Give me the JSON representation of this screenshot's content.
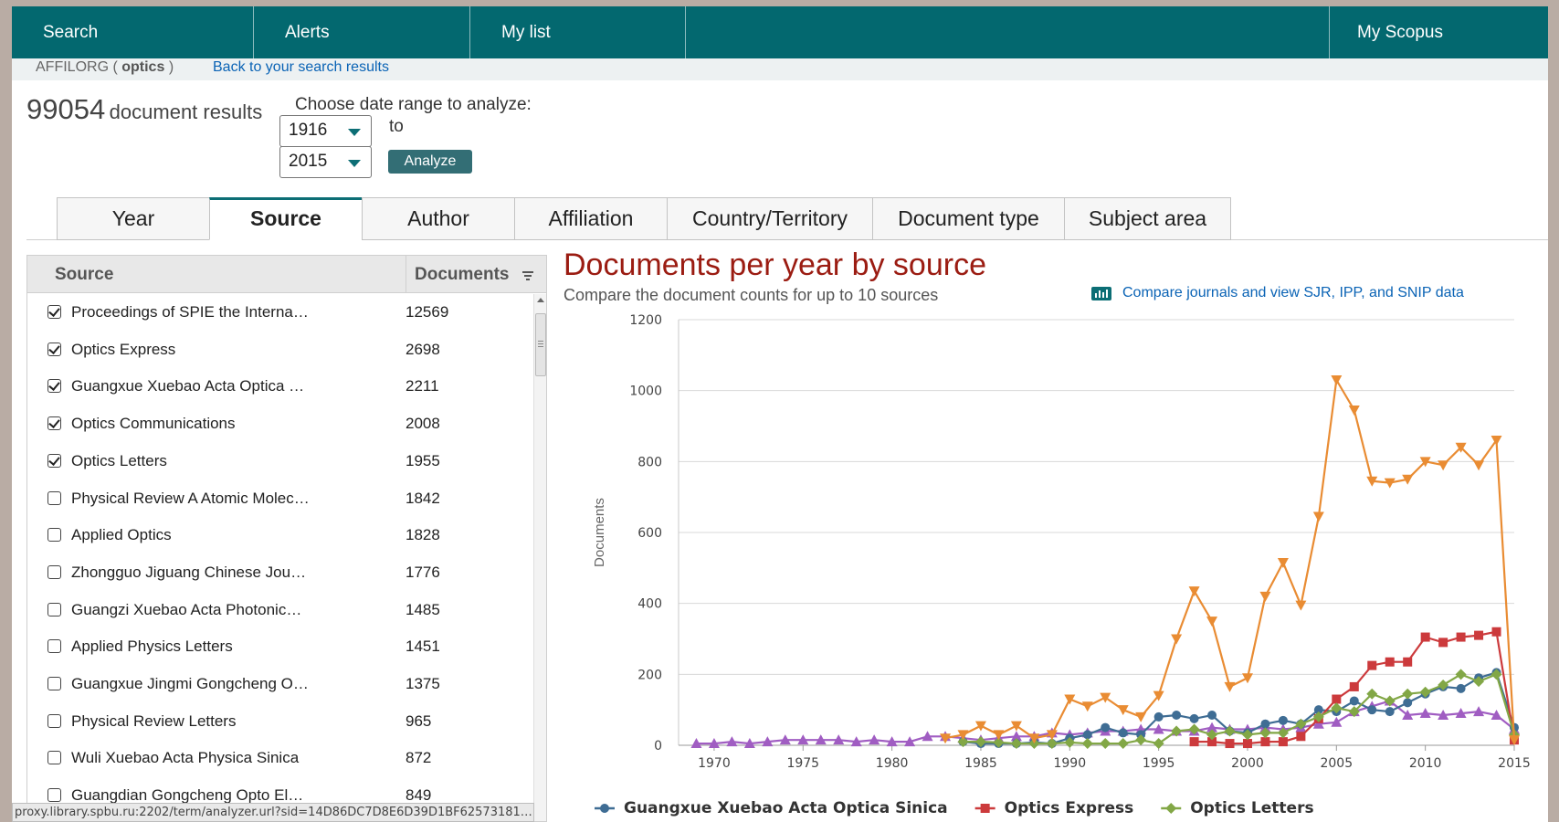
{
  "nav": {
    "search": "Search",
    "alerts": "Alerts",
    "my_list": "My list",
    "my_scopus": "My Scopus"
  },
  "query": {
    "prefix": "AFFILORG (",
    "term": "optics",
    "suffix": ")",
    "back_link": "Back to your search results"
  },
  "results": {
    "count": "99054",
    "label": "document results"
  },
  "date_range": {
    "label": "Choose date range to analyze:",
    "from": "1916",
    "to_label": "to",
    "to": "2015",
    "analyze_label": "Analyze"
  },
  "tabs": [
    {
      "label": "Year"
    },
    {
      "label": "Source"
    },
    {
      "label": "Author"
    },
    {
      "label": "Affiliation"
    },
    {
      "label": "Country/Territory"
    },
    {
      "label": "Document type"
    },
    {
      "label": "Subject area"
    }
  ],
  "active_tab": "Source",
  "sources_table": {
    "col_source": "Source",
    "col_documents": "Documents",
    "rows": [
      {
        "name": "Proceedings of SPIE the Interna…",
        "docs": "12569",
        "checked": true
      },
      {
        "name": "Optics Express",
        "docs": "2698",
        "checked": true
      },
      {
        "name": "Guangxue Xuebao Acta Optica …",
        "docs": "2211",
        "checked": true
      },
      {
        "name": "Optics Communications",
        "docs": "2008",
        "checked": true
      },
      {
        "name": "Optics Letters",
        "docs": "1955",
        "checked": true
      },
      {
        "name": "Physical Review A Atomic Molec…",
        "docs": "1842",
        "checked": false
      },
      {
        "name": "Applied Optics",
        "docs": "1828",
        "checked": false
      },
      {
        "name": "Zhongguo Jiguang Chinese Jou…",
        "docs": "1776",
        "checked": false
      },
      {
        "name": "Guangzi Xuebao Acta Photonic…",
        "docs": "1485",
        "checked": false
      },
      {
        "name": "Applied Physics Letters",
        "docs": "1451",
        "checked": false
      },
      {
        "name": "Guangxue Jingmi Gongcheng O…",
        "docs": "1375",
        "checked": false
      },
      {
        "name": "Physical Review Letters",
        "docs": "965",
        "checked": false
      },
      {
        "name": "Wuli Xuebao Acta Physica Sinica",
        "docs": "872",
        "checked": false
      },
      {
        "name": "Guangdian Gongcheng Opto El…",
        "docs": "849",
        "checked": false
      }
    ]
  },
  "status_bar": "proxy.library.spbu.ru:2202/term/analyzer.url?sid=14D86DC7D8E6D39D1BF62573181…",
  "chart_header": {
    "title": "Documents per year by source",
    "subtitle": "Compare the document counts for up to 10 sources",
    "compare_link": "Compare journals and view SJR, IPP, and SNIP data"
  },
  "colors": {
    "nav_bg": "#03686f",
    "title_red": "#9b1c12",
    "link_blue": "#0a63b5",
    "guangxue": "#3f6d94",
    "optics_express": "#cc3a3c",
    "optics_letters": "#82a746",
    "spie": "#e98c33",
    "optics_communications": "#a05dc2"
  },
  "chart_data": {
    "type": "line",
    "ylabel": "Documents",
    "xlim": [
      1968,
      2015
    ],
    "ylim": [
      0,
      1200
    ],
    "yticks": [
      0,
      200,
      400,
      600,
      800,
      1000,
      1200
    ],
    "xticks": [
      1970,
      1975,
      1980,
      1985,
      1990,
      1995,
      2000,
      2005,
      2010,
      2015
    ],
    "grid": true,
    "legend": "bottom",
    "series": [
      {
        "name": "Guangxue Xuebao Acta Optica Sinica",
        "marker": "circle",
        "x": [
          1984,
          1985,
          1986,
          1987,
          1988,
          1989,
          1990,
          1991,
          1992,
          1993,
          1994,
          1995,
          1996,
          1997,
          1998,
          1999,
          2000,
          2001,
          2002,
          2003,
          2004,
          2005,
          2006,
          2007,
          2008,
          2009,
          2010,
          2011,
          2012,
          2013,
          2014,
          2015
        ],
        "values": [
          10,
          5,
          5,
          5,
          8,
          5,
          20,
          30,
          50,
          35,
          30,
          80,
          85,
          75,
          85,
          40,
          35,
          60,
          70,
          60,
          100,
          95,
          125,
          100,
          95,
          120,
          145,
          165,
          160,
          190,
          205,
          50
        ]
      },
      {
        "name": "Optics Express",
        "marker": "square",
        "x": [
          1997,
          1998,
          1999,
          2000,
          2001,
          2002,
          2003,
          2004,
          2005,
          2006,
          2007,
          2008,
          2009,
          2010,
          2011,
          2012,
          2013,
          2014,
          2015
        ],
        "values": [
          10,
          10,
          5,
          5,
          10,
          10,
          25,
          75,
          130,
          165,
          225,
          235,
          235,
          305,
          290,
          305,
          310,
          320,
          15
        ]
      },
      {
        "name": "Optics Letters",
        "marker": "diamond",
        "x": [
          1984,
          1985,
          1986,
          1987,
          1988,
          1989,
          1990,
          1991,
          1992,
          1993,
          1994,
          1995,
          1996,
          1997,
          1998,
          1999,
          2000,
          2001,
          2002,
          2003,
          2004,
          2005,
          2006,
          2007,
          2008,
          2009,
          2010,
          2011,
          2012,
          2013,
          2014,
          2015
        ],
        "values": [
          10,
          10,
          8,
          5,
          5,
          5,
          8,
          5,
          5,
          5,
          15,
          5,
          40,
          45,
          30,
          40,
          30,
          35,
          35,
          60,
          80,
          105,
          95,
          145,
          125,
          145,
          150,
          170,
          200,
          180,
          200,
          30
        ]
      },
      {
        "marker": "triangle-down",
        "x": [
          1983,
          1984,
          1985,
          1986,
          1987,
          1988,
          1989,
          1990,
          1991,
          1992,
          1993,
          1994,
          1995,
          1996,
          1997,
          1998,
          1999,
          2000,
          2001,
          2002,
          2003,
          2004,
          2005,
          2006,
          2007,
          2008,
          2009,
          2010,
          2011,
          2012,
          2013,
          2014,
          2015
        ],
        "values": [
          20,
          30,
          55,
          30,
          55,
          20,
          30,
          130,
          110,
          135,
          100,
          80,
          140,
          300,
          435,
          350,
          165,
          190,
          420,
          515,
          395,
          645,
          1030,
          945,
          745,
          740,
          750,
          800,
          790,
          840,
          790,
          860,
          15
        ]
      },
      {
        "marker": "triangle-up",
        "x": [
          1969,
          1970,
          1971,
          1972,
          1973,
          1974,
          1975,
          1976,
          1977,
          1978,
          1979,
          1980,
          1981,
          1982,
          1983,
          1984,
          1985,
          1986,
          1987,
          1988,
          1989,
          1990,
          1991,
          1992,
          1993,
          1994,
          1995,
          1996,
          1997,
          1998,
          1999,
          2000,
          2001,
          2002,
          2003,
          2004,
          2005,
          2006,
          2007,
          2008,
          2009,
          2010,
          2011,
          2012,
          2013,
          2014,
          2015
        ],
        "values": [
          5,
          5,
          10,
          5,
          10,
          15,
          15,
          15,
          15,
          10,
          15,
          10,
          10,
          25,
          25,
          20,
          15,
          20,
          25,
          25,
          35,
          30,
          35,
          40,
          40,
          45,
          45,
          40,
          40,
          50,
          45,
          45,
          50,
          45,
          50,
          60,
          65,
          95,
          110,
          125,
          85,
          90,
          85,
          90,
          95,
          85,
          45
        ]
      }
    ]
  }
}
